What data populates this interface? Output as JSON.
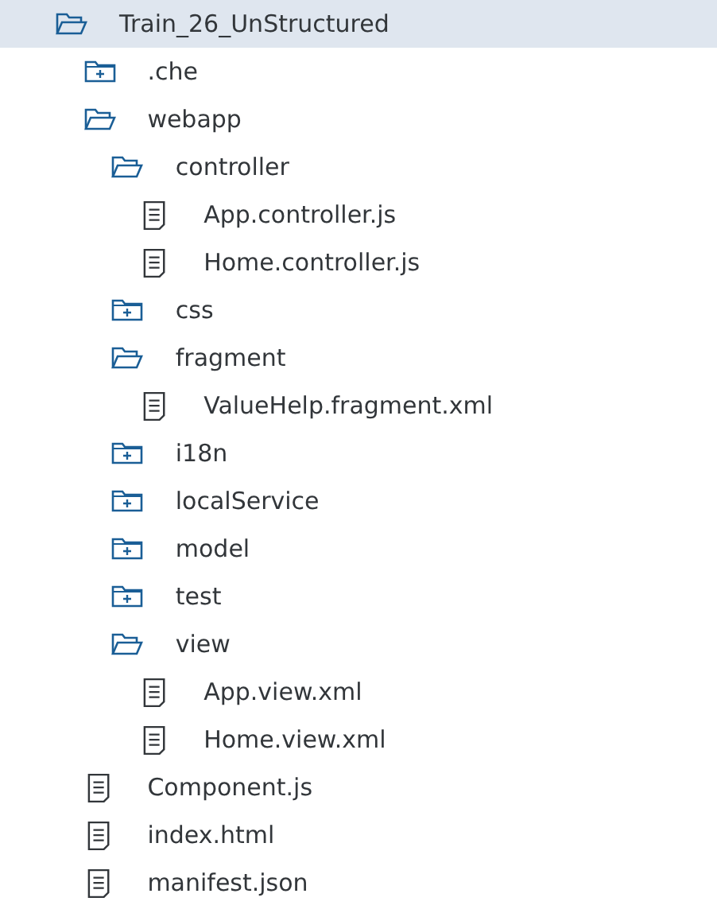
{
  "tree": [
    {
      "label": "Train_26_UnStructured",
      "kind": "folder",
      "expanded": true,
      "selected": true,
      "children": [
        {
          "label": ".che",
          "kind": "folder",
          "expanded": false,
          "selected": false
        },
        {
          "label": "webapp",
          "kind": "folder",
          "expanded": true,
          "selected": false,
          "children": [
            {
              "label": "controller",
              "kind": "folder",
              "expanded": true,
              "selected": false,
              "children": [
                {
                  "label": "App.controller.js",
                  "kind": "file",
                  "selected": false
                },
                {
                  "label": "Home.controller.js",
                  "kind": "file",
                  "selected": false
                }
              ]
            },
            {
              "label": "css",
              "kind": "folder",
              "expanded": false,
              "selected": false
            },
            {
              "label": "fragment",
              "kind": "folder",
              "expanded": true,
              "selected": false,
              "children": [
                {
                  "label": "ValueHelp.fragment.xml",
                  "kind": "file",
                  "selected": false
                }
              ]
            },
            {
              "label": "i18n",
              "kind": "folder",
              "expanded": false,
              "selected": false
            },
            {
              "label": "localService",
              "kind": "folder",
              "expanded": false,
              "selected": false
            },
            {
              "label": "model",
              "kind": "folder",
              "expanded": false,
              "selected": false
            },
            {
              "label": "test",
              "kind": "folder",
              "expanded": false,
              "selected": false
            },
            {
              "label": "view",
              "kind": "folder",
              "expanded": true,
              "selected": false,
              "children": [
                {
                  "label": "App.view.xml",
                  "kind": "file",
                  "selected": false
                },
                {
                  "label": "Home.view.xml",
                  "kind": "file",
                  "selected": false
                }
              ]
            }
          ]
        },
        {
          "label": "Component.js",
          "kind": "file",
          "selected": false
        },
        {
          "label": "index.html",
          "kind": "file",
          "selected": false
        },
        {
          "label": "manifest.json",
          "kind": "file",
          "selected": false
        }
      ]
    }
  ]
}
